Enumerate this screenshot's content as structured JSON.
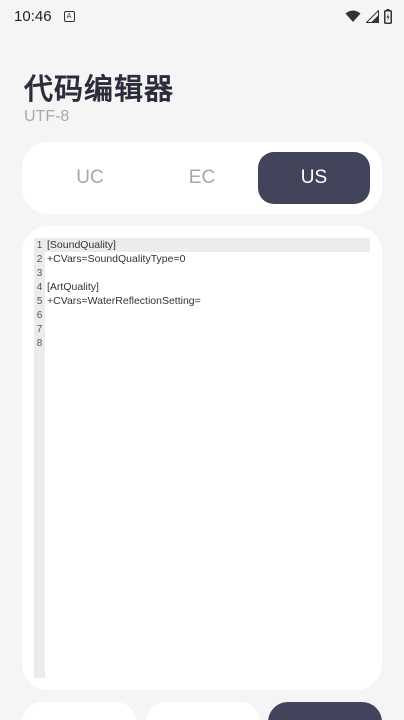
{
  "status": {
    "time": "10:46",
    "app_icon_letter": "A"
  },
  "header": {
    "title": "代码编辑器",
    "subtitle": "UTF-8"
  },
  "tabs": [
    {
      "label": "UC",
      "active": false
    },
    {
      "label": "EC",
      "active": false
    },
    {
      "label": "US",
      "active": true
    }
  ],
  "editor": {
    "lines": [
      {
        "num": "1",
        "text": "[SoundQuality]"
      },
      {
        "num": "2",
        "text": "+CVars=SoundQualityType=0"
      },
      {
        "num": "3",
        "text": ""
      },
      {
        "num": "4",
        "text": "[ArtQuality]"
      },
      {
        "num": "5",
        "text": "+CVars=WaterReflectionSetting="
      },
      {
        "num": "6",
        "text": ""
      },
      {
        "num": "7",
        "text": ""
      },
      {
        "num": "8",
        "text": ""
      }
    ],
    "current_line": 1
  },
  "colors": {
    "background": "#f5f5f6",
    "card": "#ffffff",
    "accent_dark": "#41445a",
    "muted_text": "#a6a7ac"
  },
  "icons": {
    "wifi": "wifi-icon",
    "signal": "signal-icon",
    "battery": "battery-icon",
    "app": "notification-app-icon"
  }
}
